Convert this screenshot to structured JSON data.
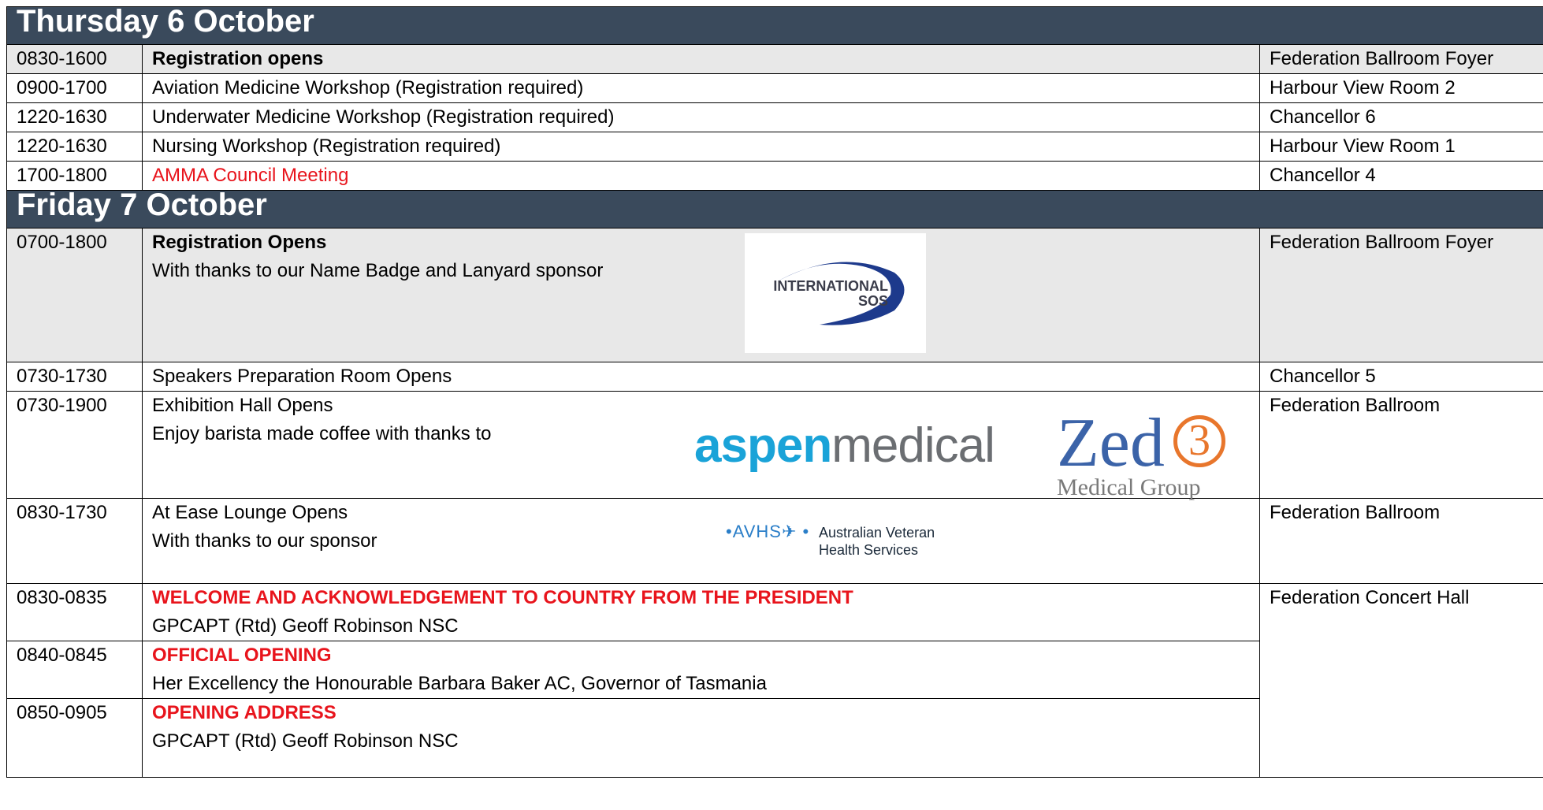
{
  "thursday": {
    "heading": "Thursday 6 October",
    "rows": [
      {
        "time": "0830-1600",
        "title": "Registration opens",
        "venue": "Federation Ballroom Foyer"
      },
      {
        "time": "0900-1700",
        "title": "Aviation Medicine Workshop (Registration required)",
        "venue": "Harbour View Room 2"
      },
      {
        "time": "1220-1630",
        "title": "Underwater Medicine Workshop (Registration required)",
        "venue": "Chancellor 6"
      },
      {
        "time": "1220-1630",
        "title": "Nursing Workshop (Registration required)",
        "venue": "Harbour View Room 1"
      },
      {
        "time": "1700-1800",
        "title": "AMMA Council Meeting",
        "venue": "Chancellor 4"
      }
    ]
  },
  "friday": {
    "heading": "Friday 7 October",
    "registration": {
      "time": "0700-1800",
      "title": "Registration Opens",
      "sub": "With thanks to our Name Badge and Lanyard sponsor",
      "venue": "Federation Ballroom Foyer",
      "logo_text_1": "INTERNATIONAL",
      "logo_text_2": "SOS"
    },
    "speakers": {
      "time": "0730-1730",
      "title": "Speakers Preparation Room Opens",
      "venue": "Chancellor 5"
    },
    "exhibition": {
      "time": "0730-1900",
      "title": "Exhibition Hall Opens",
      "sub": "Enjoy barista made coffee with thanks to",
      "venue": "Federation Ballroom",
      "aspen_1": "aspen",
      "aspen_2": "medical",
      "zed_word": "Zed",
      "zed_num": "3",
      "zed_sub": "Medical Group"
    },
    "lounge": {
      "time": "0830-1730",
      "title": "At Ease Lounge Opens",
      "sub": "With thanks to our sponsor",
      "venue": "Federation Ballroom",
      "avhs_mark": "•AVHS✈ •",
      "avhs_name_1": "Australian Veteran",
      "avhs_name_2": "Health Services"
    },
    "welcome": {
      "time": "0830-0835",
      "title": "WELCOME AND ACKNOWLEDGEMENT TO COUNTRY FROM THE PRESIDENT",
      "sub": "GPCAPT (Rtd) Geoff Robinson NSC",
      "venue": "Federation Concert Hall"
    },
    "opening": {
      "time": "0840-0845",
      "title": "OFFICIAL OPENING",
      "sub": "Her Excellency the Honourable Barbara Baker AC, Governor of Tasmania"
    },
    "address": {
      "time": "0850-0905",
      "title": "OPENING ADDRESS",
      "sub": "GPCAPT (Rtd) Geoff Robinson NSC"
    }
  },
  "colors": {
    "header_bg": "#3a4a5c",
    "highlight": "#e8141c",
    "grey_row": "#e8e8e8"
  }
}
